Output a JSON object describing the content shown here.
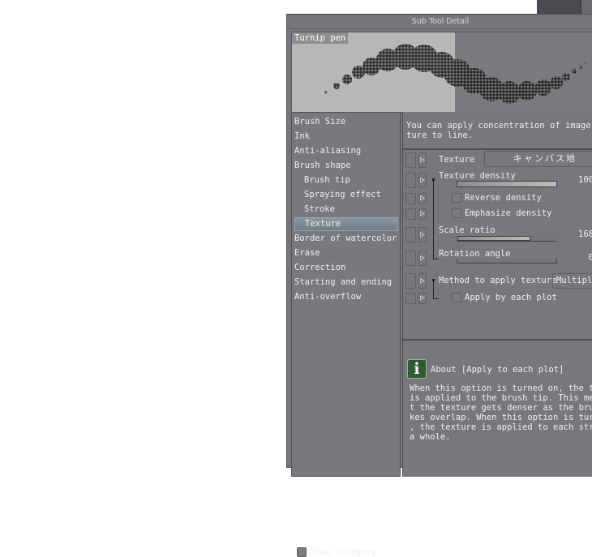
{
  "window": {
    "title": "Sub Tool Detail"
  },
  "preview": {
    "tool_name": "Turnip pen"
  },
  "categories": [
    {
      "label": "Brush Size",
      "sub": false,
      "selected": false
    },
    {
      "label": "Ink",
      "sub": false,
      "selected": false
    },
    {
      "label": "Anti-aliasing",
      "sub": false,
      "selected": false
    },
    {
      "label": "Brush shape",
      "sub": false,
      "selected": false
    },
    {
      "label": "Brush tip",
      "sub": true,
      "selected": false
    },
    {
      "label": "Spraying effect",
      "sub": true,
      "selected": false
    },
    {
      "label": "Stroke",
      "sub": true,
      "selected": false
    },
    {
      "label": "Texture",
      "sub": true,
      "selected": true
    },
    {
      "label": "Border of watercolor",
      "sub": false,
      "selected": false
    },
    {
      "label": "Erase",
      "sub": false,
      "selected": false
    },
    {
      "label": "Correction",
      "sub": false,
      "selected": false
    },
    {
      "label": "Starting and ending",
      "sub": false,
      "selected": false
    },
    {
      "label": "Anti-overflow",
      "sub": false,
      "selected": false
    }
  ],
  "show_category": {
    "label": "Show category",
    "checked": false
  },
  "description": "You can apply concentration of image as\nture to line.",
  "settings": {
    "texture": {
      "label": "Texture",
      "value": "キャンバス地"
    },
    "texture_density": {
      "label": "Texture density",
      "value": "100",
      "fraction": 1.0
    },
    "reverse_density": {
      "label": "Reverse density",
      "checked": false
    },
    "emphasize_density": {
      "label": "Emphasize density",
      "checked": false
    },
    "scale_ratio": {
      "label": "Scale ratio",
      "value": "168",
      "fraction": 0.74
    },
    "rotation_angle": {
      "label": "Rotation angle",
      "value": "0",
      "fraction": 0
    },
    "method": {
      "label": "Method to apply texture",
      "value": "Multipl"
    },
    "apply_each_plot": {
      "label": "Apply by each plot",
      "checked": false
    }
  },
  "info": {
    "title": "About [Apply to each plot]",
    "body": "When this option is turned on, the tex\nis applied to the brush tip. This mean\nt the texture gets denser as the brush\nkes overlap. When this option is turne\n, the texture is applied to each strok\na whole."
  }
}
